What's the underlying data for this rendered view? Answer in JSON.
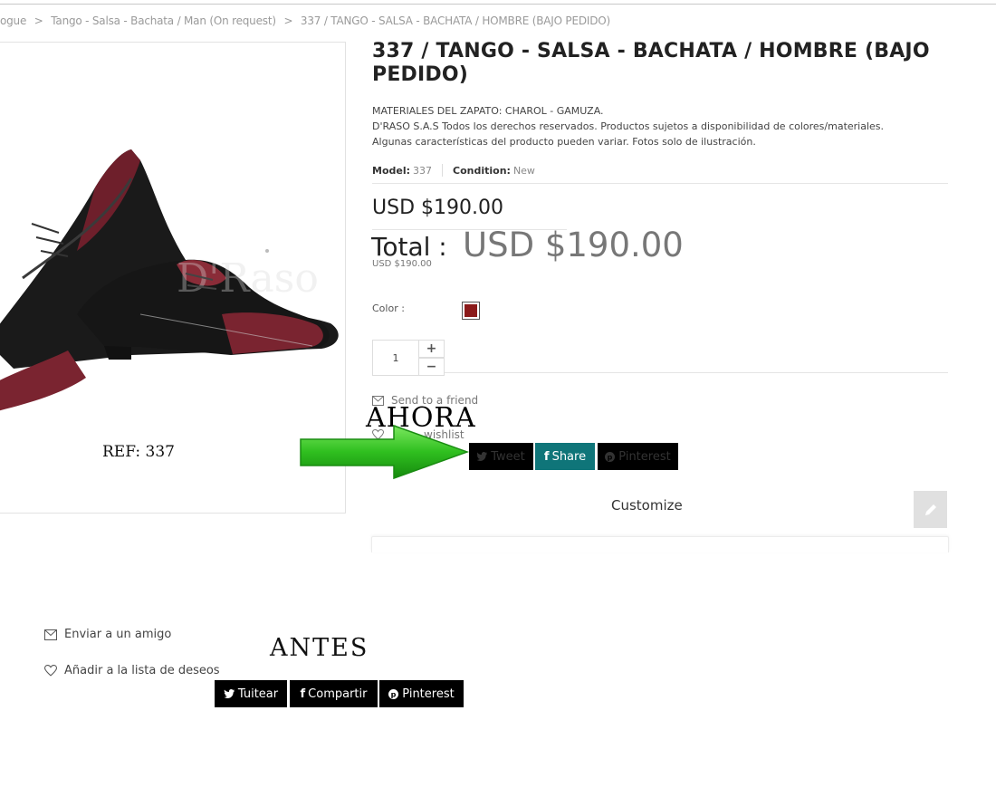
{
  "breadcrumb": {
    "items": [
      "ogue",
      "Tango - Salsa - Bachata / Man (On request)",
      "337 / TANGO - SALSA - BACHATA / HOMBRE (BAJO PEDIDO)"
    ],
    "separator": ">"
  },
  "product": {
    "image_ref_label": "REF: 337",
    "image_watermark": "D'Raso",
    "title": "337 / TANGO - SALSA - BACHATA / HOMBRE (BAJO PEDIDO)",
    "description_lines": [
      "MATERIALES DEL ZAPATO: CHAROL - GAMUZA.",
      "D'RASO S.A.S Todos los derechos reservados. Productos sujetos a disponibilidad de colores/materiales.",
      "Algunas características del producto pueden variar. Fotos solo de ilustración."
    ],
    "model_label": "Model:",
    "model_value": "337",
    "condition_label": "Condition:",
    "condition_value": "New",
    "price": "USD $190.00",
    "total_label": "Total :",
    "total_value": "USD $190.00",
    "total_small": "USD $190.00",
    "color_label": "Color :",
    "color_value": "#8b1a1a",
    "quantity": "1",
    "qty_plus": "+",
    "qty_minus": "−"
  },
  "ahora": {
    "heading": "AHORA",
    "send_to_friend": "Send to a friend",
    "wishlist_partial": "wishlist",
    "tweet": "Tweet",
    "share": "Share",
    "pinterest": "Pinterest",
    "share_color": "#0f7579"
  },
  "customize": {
    "label": "Customize",
    "edit_icon": "pencil-icon"
  },
  "antes": {
    "heading": "ANTES",
    "send_to_friend": "Enviar a un amigo",
    "wishlist": "Añadir a la lista de deseos",
    "tweet": "Tuitear",
    "share": "Compartir",
    "pinterest": "Pinterest"
  },
  "arrow": {
    "color": "#2fbf1f",
    "icon": "arrow-right-icon"
  }
}
